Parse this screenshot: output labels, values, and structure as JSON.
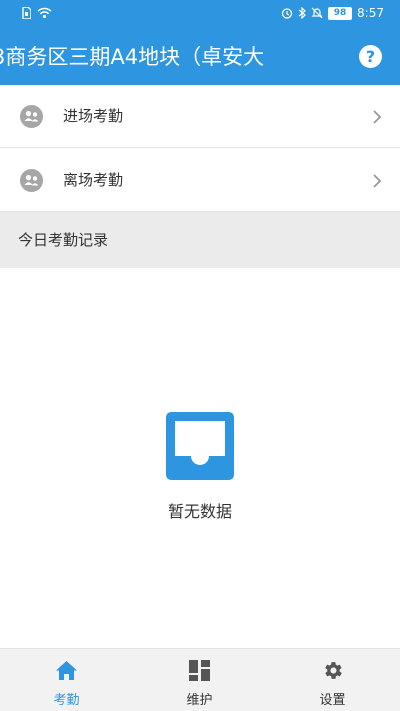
{
  "status_bar": {
    "battery": "98",
    "time": "8:57"
  },
  "header": {
    "title": "3商务区三期A4地块（卓安大",
    "help_icon": "question-circle-icon",
    "help_label": "?"
  },
  "menu": {
    "items": [
      {
        "label": "进场考勤",
        "icon": "people-icon"
      },
      {
        "label": "离场考勤",
        "icon": "people-icon"
      }
    ]
  },
  "records": {
    "section_title": "今日考勤记录",
    "empty_text": "暂无数据",
    "empty_icon": "inbox-icon"
  },
  "tabbar": {
    "tabs": [
      {
        "label": "考勤",
        "icon": "home-icon",
        "active": true
      },
      {
        "label": "维护",
        "icon": "grid-icon",
        "active": false
      },
      {
        "label": "设置",
        "icon": "gear-icon",
        "active": false
      }
    ]
  },
  "colors": {
    "primary": "#2e96e0",
    "icon_gray": "#a6a6a6",
    "section_bg": "#ebebeb"
  }
}
